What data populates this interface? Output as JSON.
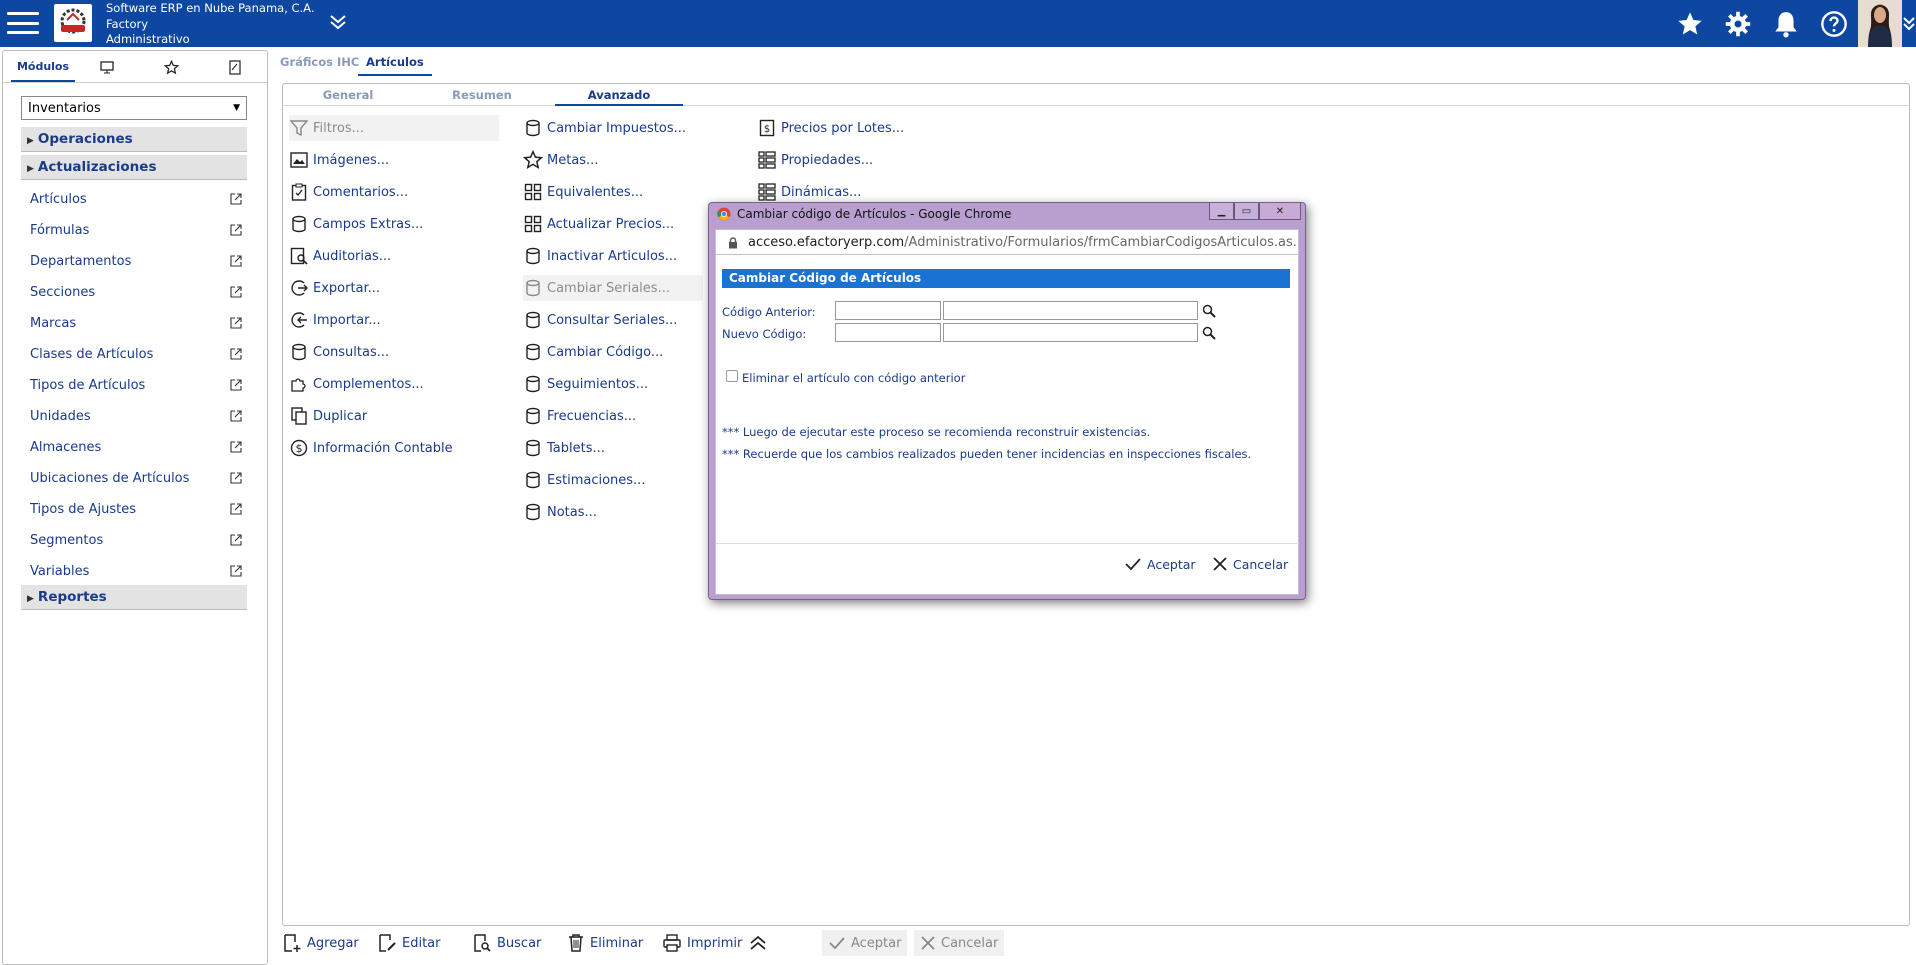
{
  "header": {
    "company_line1": "Software ERP en Nube Panama, C.A.",
    "company_line2": "Factory",
    "company_line3": "Administrativo"
  },
  "sidebar": {
    "tabs": [
      {
        "label": "Módulos",
        "icon": "text"
      },
      {
        "label": "",
        "icon": "monitor-icon"
      },
      {
        "label": "",
        "icon": "star-icon"
      },
      {
        "label": "",
        "icon": "document-icon"
      }
    ],
    "module_select": "Inventarios",
    "groups": {
      "operaciones": "Operaciones",
      "actualizaciones": "Actualizaciones",
      "reportes": "Reportes"
    },
    "items": [
      "Artículos",
      "Fórmulas",
      "Departamentos",
      "Secciones",
      "Marcas",
      "Clases de Artículos",
      "Tipos de Artículos",
      "Unidades",
      "Almacenes",
      "Ubicaciones de Artículos",
      "Tipos de Ajustes",
      "Segmentos",
      "Variables"
    ]
  },
  "main_tabs": {
    "graficos": "Gráficos IHC",
    "articulos": "Artículos"
  },
  "inner_tabs": {
    "general": "General",
    "resumen": "Resumen",
    "avanzado": "Avanzado"
  },
  "options": {
    "col1": [
      "Filtros...",
      "Imágenes...",
      "Comentarios...",
      "Campos Extras...",
      "Auditorias...",
      "Exportar...",
      "Importar...",
      "Consultas...",
      "Complementos...",
      "Duplicar",
      "Información Contable"
    ],
    "col2": [
      "Cambiar Impuestos...",
      "Metas...",
      "Equivalentes...",
      "Actualizar Precios...",
      "Inactivar Articulos...",
      "Cambiar Seriales...",
      "Consultar Seriales...",
      "Cambiar Código...",
      "Seguimientos...",
      "Frecuencias...",
      "Tablets...",
      "Estimaciones...",
      "Notas..."
    ],
    "col3": [
      "Precios por Lotes...",
      "Propiedades...",
      "Dinámicas..."
    ]
  },
  "bottom_toolbar": {
    "agregar": "Agregar",
    "editar": "Editar",
    "buscar": "Buscar",
    "eliminar": "Eliminar",
    "imprimir": "Imprimir",
    "aceptar": "Aceptar",
    "cancelar": "Cancelar"
  },
  "dialog": {
    "window_title": "Cambiar código de Artículos - Google Chrome",
    "url_host": "acceso.efactoryerp.com",
    "url_path": "/Administrativo/Formularios/frmCambiarCodigosArticulos.as...",
    "heading": "Cambiar Código de Artículos",
    "label_old": "Código Anterior:",
    "label_new": "Nuevo Código:",
    "checkbox_label": "Eliminar el artículo con código anterior",
    "note1": "*** Luego de ejecutar este proceso se recomienda reconstruir existencias.",
    "note2": "*** Recuerde que los cambios realizados pueden tener incidencias en inspecciones fiscales.",
    "accept": "Aceptar",
    "cancel": "Cancelar"
  },
  "colors": {
    "header_bg": "#0d47a1",
    "link": "#1a3a8a",
    "dialog_frame": "#b89fcf",
    "dialog_heading": "#1a73d2"
  }
}
